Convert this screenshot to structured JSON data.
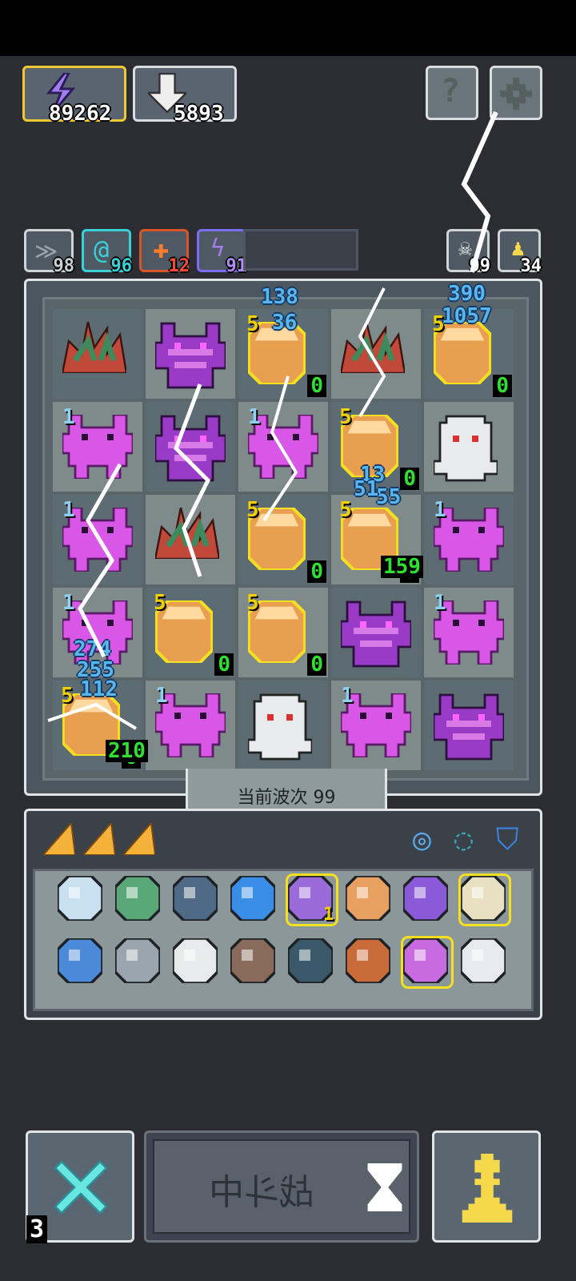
{
  "resources": {
    "energy": "89262",
    "gems": "5893"
  },
  "top_buttons": {
    "help_icon": "question-icon",
    "settings_icon": "gear-icon"
  },
  "stat_chips": [
    {
      "icon": "wing-icon",
      "value": "98",
      "color": "#9aa5ad"
    },
    {
      "icon": "swirl-icon",
      "value": "96",
      "color": "#3ad0d8"
    },
    {
      "icon": "plus-icon",
      "value": "12",
      "color": "#ff4a3a"
    },
    {
      "icon": "lightning-icon",
      "value": "91",
      "color": "#a47cf0"
    }
  ],
  "right_chips": [
    {
      "icon": "skull-icon",
      "value": "99"
    },
    {
      "icon": "pawn-icon",
      "value": "34"
    }
  ],
  "board": {
    "wave_label": "当前波次 99",
    "floating_damage": [
      "138",
      "36",
      "390",
      "1057",
      "13",
      "55",
      "51",
      "274",
      "255",
      "112"
    ],
    "green_values": [
      "0",
      "0",
      "0",
      "0",
      "0",
      "159",
      "210",
      "0",
      "0"
    ],
    "yellow_tags": [
      "5",
      "5",
      "5",
      "5",
      "5",
      "5",
      "5",
      "5"
    ],
    "blue_level": "1"
  },
  "inventory": {
    "shards": [
      "shard-icon",
      "shard-icon",
      "shard-icon"
    ],
    "status_icons": [
      "ring-icon",
      "cycle-icon",
      "helmet-icon"
    ],
    "row1": [
      "scroll-icon",
      "turtle-shell-icon",
      "shield-icon",
      "wave-icon",
      "potion-icon",
      "key-icon",
      "bat-icon",
      "crown-icon"
    ],
    "row1_badge": "1",
    "row2": [
      "feather-icon",
      "joystick-icon",
      "orb-icon",
      "slingshot-icon",
      "bell-icon",
      "dagger-icon",
      "hammer-icon",
      "mirror-icon"
    ]
  },
  "bottom": {
    "left_count": "3",
    "battle_label": "战斗中",
    "right_icon": "pawn-icon"
  },
  "colors": {
    "accent_gold": "#f0c830",
    "monster_purple": "#d957e6",
    "crate_orange": "#e8a050"
  }
}
